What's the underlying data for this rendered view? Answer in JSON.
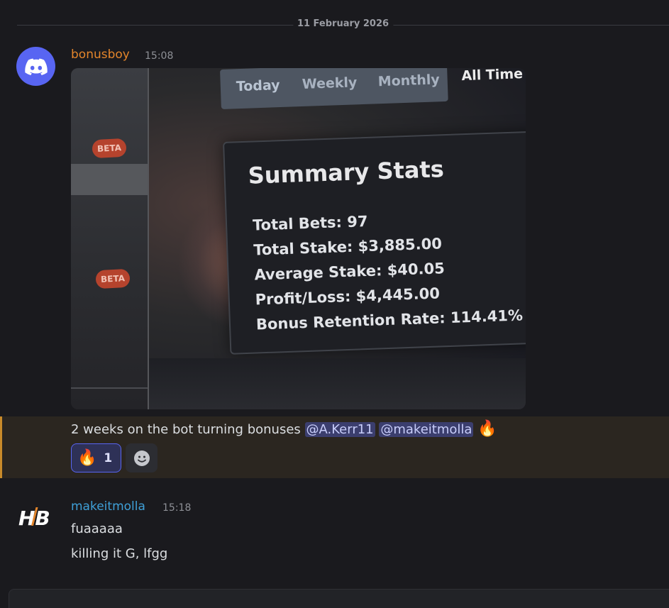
{
  "date_divider": "11 February 2026",
  "messages": [
    {
      "username": "bonusboy",
      "time": "15:08",
      "avatar_icon": "discord-logo-icon",
      "image": {
        "tabs": [
          "Today",
          "Weekly",
          "Monthly",
          "All Time"
        ],
        "badges": [
          "BETA",
          "BETA"
        ],
        "card_title": "Summary Stats",
        "stats": [
          "Total Bets: 97",
          "Total Stake: $3,885.00",
          "Average Stake: $40.05",
          "Profit/Loss: $4,445.00",
          "Bonus Retention Rate: 114.41%"
        ]
      },
      "text": "2 weeks on the bot turning bonuses",
      "mentions": [
        "@A.Kerr11",
        "@makeitmolla"
      ],
      "trailing_emoji": "🔥",
      "reaction": {
        "emoji": "🔥",
        "count": "1"
      },
      "add_reaction_icon": "smiley-add-reaction-icon"
    },
    {
      "username": "makeitmolla",
      "time": "15:18",
      "avatar_text": "HB",
      "lines": [
        "fuaaaaa",
        "killing it G, lfgg"
      ]
    }
  ],
  "colors": {
    "background": "#1a1a1e",
    "username_1": "#e3852b",
    "username_2": "#3fa0d8",
    "highlight_bar": "#c88a2a",
    "mention_bg": "#3b3e6e",
    "blurple": "#5865f2"
  }
}
